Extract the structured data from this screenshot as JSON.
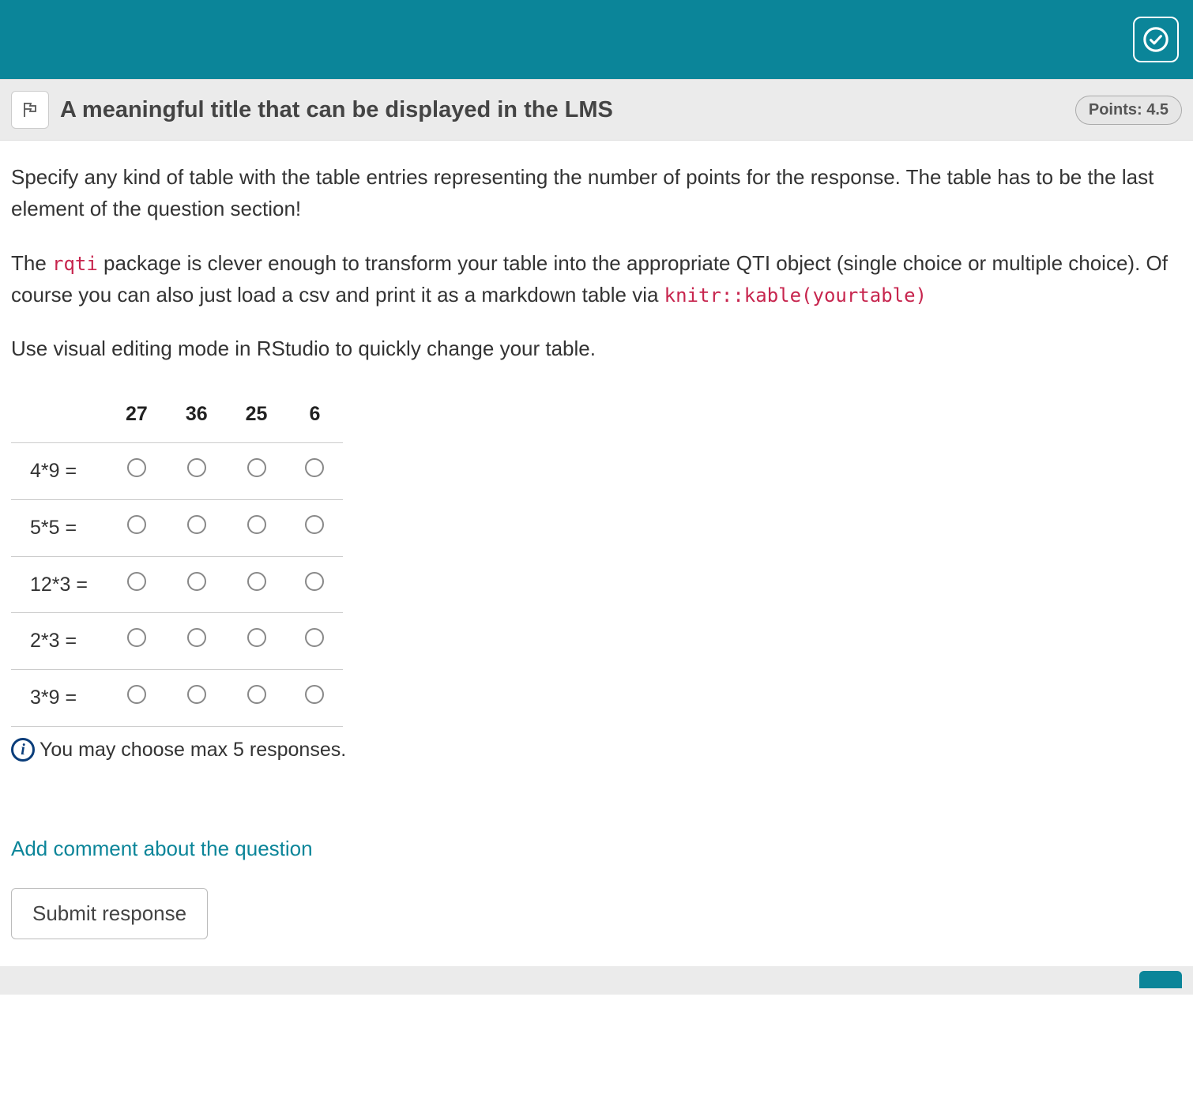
{
  "header": {
    "title": "A meaningful title that can be displayed in the LMS",
    "points_label": "Points: 4.5"
  },
  "body": {
    "p1": "Specify any kind of table with the table entries representing the number of points for the response. The table has to be the last element of the question section!",
    "p2a": "The ",
    "p2_code1": "rqti",
    "p2b": " package is clever enough to transform your table into the appropriate QTI object (single choice or multiple choice). Of course you can also just load a csv and print it as a markdown table via ",
    "p2_code2": "knitr::kable(yourtable)",
    "p3": "Use visual editing mode in RStudio to quickly change your table."
  },
  "table": {
    "columns": [
      "27",
      "36",
      "25",
      "6"
    ],
    "rows": [
      "4*9 =",
      "5*5 =",
      "12*3 =",
      "2*3 =",
      "3*9 ="
    ]
  },
  "info_text": "You may choose max 5 responses.",
  "comment_link": "Add comment about the question",
  "submit_label": "Submit response"
}
